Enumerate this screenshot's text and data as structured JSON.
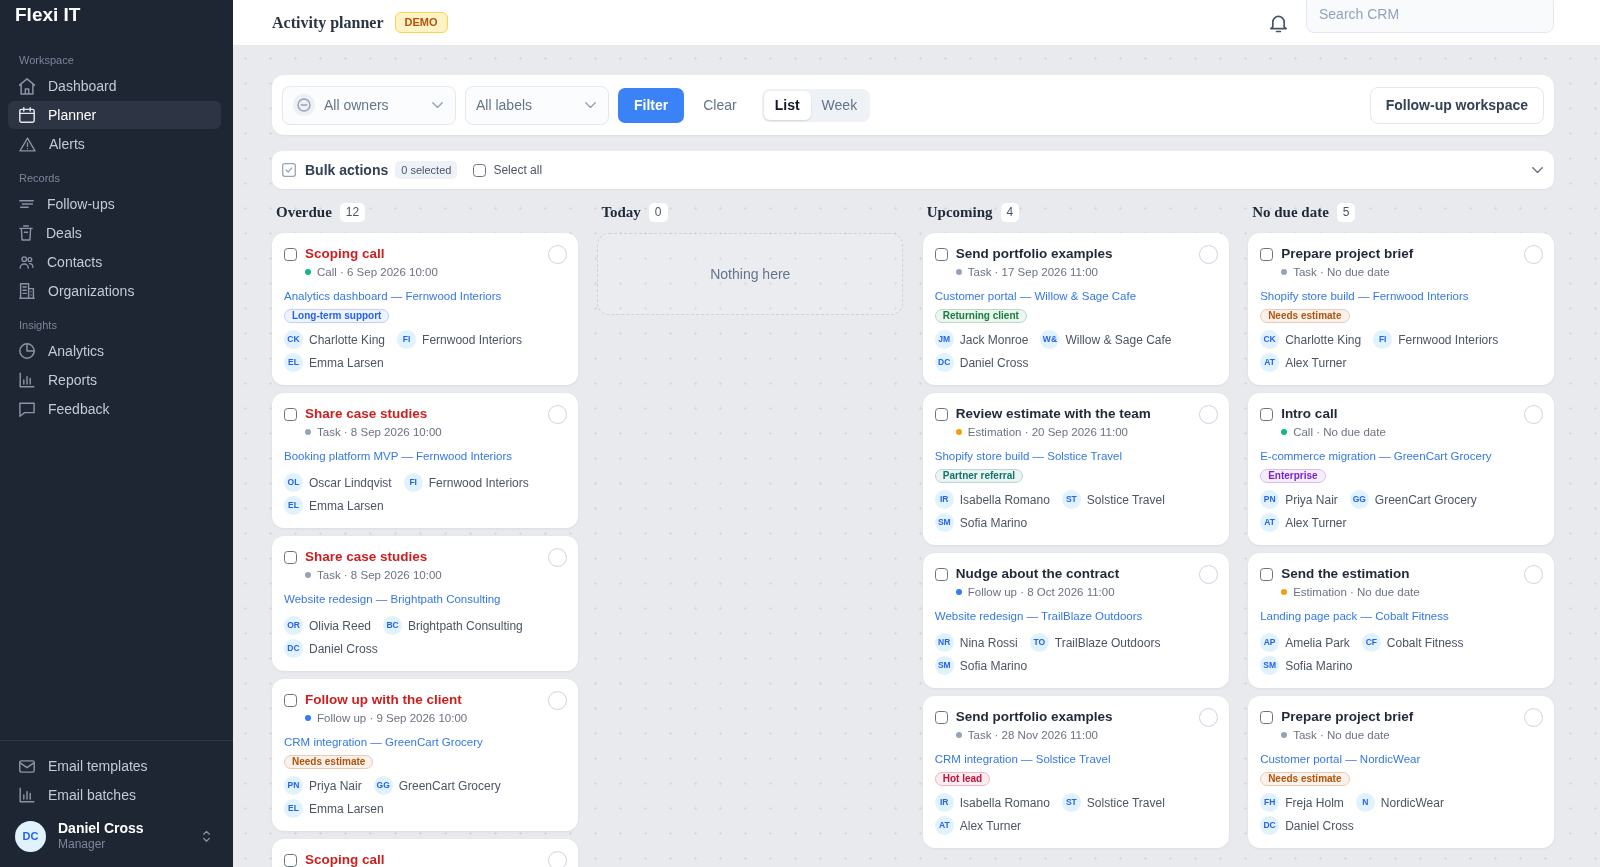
{
  "sidebar": {
    "logo": "Flexi IT",
    "sections": [
      {
        "label": "Workspace",
        "items": [
          {
            "label": "Dashboard",
            "selected": false
          },
          {
            "label": "Planner",
            "selected": true
          },
          {
            "label": "Alerts",
            "selected": false
          }
        ]
      },
      {
        "label": "Records",
        "items": [
          {
            "label": "Follow-ups",
            "selected": false
          },
          {
            "label": "Deals",
            "selected": false
          },
          {
            "label": "Contacts",
            "selected": false
          },
          {
            "label": "Organizations",
            "selected": false
          }
        ]
      },
      {
        "label": "Insights",
        "items": [
          {
            "label": "Analytics",
            "selected": false
          },
          {
            "label": "Reports",
            "selected": false
          },
          {
            "label": "Feedback",
            "selected": false
          }
        ]
      }
    ],
    "footer_items": [
      {
        "label": "Email templates",
        "selected": false
      },
      {
        "label": "Email batches",
        "selected": false
      }
    ],
    "user": {
      "initials": "DC",
      "name": "Daniel Cross",
      "role": "Manager"
    }
  },
  "header": {
    "title": "Activity planner",
    "badge": "DEMO",
    "search": {
      "placeholder": "Search CRM"
    }
  },
  "toolbar": {
    "owner_filter": "All owners",
    "label_filter": "All labels",
    "filter_button": "Filter",
    "clear_button": "Clear",
    "views": [
      {
        "label": "List",
        "selected": true
      },
      {
        "label": "Week",
        "selected": false
      }
    ],
    "workspace_button": "Follow-up workspace"
  },
  "bulk_actions": {
    "title": "Bulk actions",
    "selected_count": "0 selected",
    "select_all": {
      "label": "Select all",
      "checked": false
    },
    "expanded": false
  },
  "columns": [
    {
      "title": "Overdue",
      "count": "12",
      "overdue": true,
      "cards": [
        {
          "title": "Scoping call",
          "checked": false,
          "done": false,
          "color": "#10b981",
          "meta": "Call · 6 Sep 2026 10:00",
          "project": "Analytics dashboard — Fernwood Interiors",
          "tag": {
            "text": "Long-term support",
            "color": "#2563eb"
          },
          "contact": {
            "initials": "CK",
            "name": "Charlotte King"
          },
          "organization": {
            "initials": "FI",
            "name": "Fernwood Interiors"
          },
          "owner": {
            "initials": "EL",
            "name": "Emma Larsen"
          }
        },
        {
          "title": "Share case studies",
          "checked": false,
          "done": false,
          "color": "#94a3b8",
          "meta": "Task · 8 Sep 2026 10:00",
          "project": "Booking platform MVP — Fernwood Interiors",
          "contact": {
            "initials": "OL",
            "name": "Oscar Lindqvist"
          },
          "organization": {
            "initials": "FI",
            "name": "Fernwood Interiors"
          },
          "owner": {
            "initials": "EL",
            "name": "Emma Larsen"
          }
        },
        {
          "title": "Share case studies",
          "checked": false,
          "done": false,
          "color": "#94a3b8",
          "meta": "Task · 8 Sep 2026 10:00",
          "project": "Website redesign — Brightpath Consulting",
          "contact": {
            "initials": "OR",
            "name": "Olivia Reed"
          },
          "organization": {
            "initials": "BC",
            "name": "Brightpath Consulting"
          },
          "owner": {
            "initials": "DC",
            "name": "Daniel Cross"
          }
        },
        {
          "title": "Follow up with the client",
          "checked": false,
          "done": false,
          "color": "#2f7cf6",
          "meta": "Follow up · 9 Sep 2026 10:00",
          "project": "CRM integration — GreenCart Grocery",
          "tag": {
            "text": "Needs estimate",
            "color": "#b45309"
          },
          "contact": {
            "initials": "PN",
            "name": "Priya Nair"
          },
          "organization": {
            "initials": "GG",
            "name": "GreenCart Grocery"
          },
          "owner": {
            "initials": "EL",
            "name": "Emma Larsen"
          }
        },
        {
          "title": "Scoping call",
          "checked": false,
          "done": false
        }
      ]
    },
    {
      "title": "Today",
      "count": "0",
      "empty_text": "Nothing here"
    },
    {
      "title": "Upcoming",
      "count": "4",
      "overdue": false,
      "cards": [
        {
          "title": "Send portfolio examples",
          "checked": false,
          "done": false,
          "color": "#94a3b8",
          "meta": "Task · 17 Sep 2026 11:00",
          "project": "Customer portal — Willow & Sage Cafe",
          "tag": {
            "text": "Returning client",
            "color": "#15803d"
          },
          "contact": {
            "initials": "JM",
            "name": "Jack Monroe"
          },
          "organization": {
            "initials": "W&",
            "name": "Willow & Sage Cafe"
          },
          "owner": {
            "initials": "DC",
            "name": "Daniel Cross"
          }
        },
        {
          "title": "Review estimate with the team",
          "checked": false,
          "done": false,
          "color": "#f59e0b",
          "meta": "Estimation · 20 Sep 2026 11:00",
          "project": "Shopify store build — Solstice Travel",
          "tag": {
            "text": "Partner referral",
            "color": "#0f766e"
          },
          "contact": {
            "initials": "IR",
            "name": "Isabella Romano"
          },
          "organization": {
            "initials": "ST",
            "name": "Solstice Travel"
          },
          "owner": {
            "initials": "SM",
            "name": "Sofia Marino"
          }
        },
        {
          "title": "Nudge about the contract",
          "checked": false,
          "done": false,
          "color": "#2f7cf6",
          "meta": "Follow up · 8 Oct 2026 11:00",
          "project": "Website redesign — TrailBlaze Outdoors",
          "contact": {
            "initials": "NR",
            "name": "Nina Rossi"
          },
          "organization": {
            "initials": "TO",
            "name": "TrailBlaze Outdoors"
          },
          "owner": {
            "initials": "SM",
            "name": "Sofia Marino"
          }
        },
        {
          "title": "Send portfolio examples",
          "checked": false,
          "done": false,
          "color": "#94a3b8",
          "meta": "Task · 28 Nov 2026 11:00",
          "project": "CRM integration — Solstice Travel",
          "tag": {
            "text": "Hot lead",
            "color": "#be123c"
          },
          "contact": {
            "initials": "IR",
            "name": "Isabella Romano"
          },
          "organization": {
            "initials": "ST",
            "name": "Solstice Travel"
          },
          "owner": {
            "initials": "AT",
            "name": "Alex Turner"
          }
        }
      ]
    },
    {
      "title": "No due date",
      "count": "5",
      "overdue": false,
      "cards": [
        {
          "title": "Prepare project brief",
          "checked": false,
          "done": false,
          "color": "#94a3b8",
          "meta": "Task · No due date",
          "project": "Shopify store build — Fernwood Interiors",
          "tag": {
            "text": "Needs estimate",
            "color": "#b45309"
          },
          "contact": {
            "initials": "CK",
            "name": "Charlotte King"
          },
          "organization": {
            "initials": "FI",
            "name": "Fernwood Interiors"
          },
          "owner": {
            "initials": "AT",
            "name": "Alex Turner"
          }
        },
        {
          "title": "Intro call",
          "checked": false,
          "done": false,
          "color": "#10b981",
          "meta": "Call · No due date",
          "project": "E-commerce migration — GreenCart Grocery",
          "tag": {
            "text": "Enterprise",
            "color": "#7e22ce"
          },
          "contact": {
            "initials": "PN",
            "name": "Priya Nair"
          },
          "organization": {
            "initials": "GG",
            "name": "GreenCart Grocery"
          },
          "owner": {
            "initials": "AT",
            "name": "Alex Turner"
          }
        },
        {
          "title": "Send the estimation",
          "checked": false,
          "done": false,
          "color": "#f59e0b",
          "meta": "Estimation · No due date",
          "project": "Landing page pack — Cobalt Fitness",
          "contact": {
            "initials": "AP",
            "name": "Amelia Park"
          },
          "organization": {
            "initials": "CF",
            "name": "Cobalt Fitness"
          },
          "owner": {
            "initials": "SM",
            "name": "Sofia Marino"
          }
        },
        {
          "title": "Prepare project brief",
          "checked": false,
          "done": false,
          "color": "#94a3b8",
          "meta": "Task · No due date",
          "project": "Customer portal — NordicWear",
          "tag": {
            "text": "Needs estimate",
            "color": "#b45309"
          },
          "contact": {
            "initials": "FH",
            "name": "Freja Holm"
          },
          "organization": {
            "initials": "N",
            "name": "NordicWear"
          },
          "owner": {
            "initials": "DC",
            "name": "Daniel Cross"
          }
        }
      ]
    }
  ]
}
